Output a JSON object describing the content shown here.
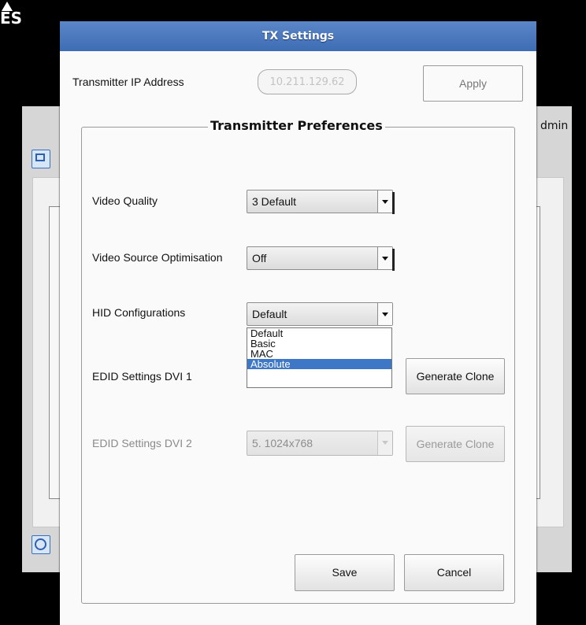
{
  "background": {
    "logo_text": "ES",
    "admin_text": "dmin"
  },
  "dialog": {
    "title": "TX Settings",
    "ip_label": "Transmitter IP Address",
    "ip_value": "10.211.129.62",
    "apply_label": "Apply",
    "group_title": "Transmitter Preferences",
    "fields": {
      "video_quality": {
        "label": "Video Quality",
        "value": "3 Default"
      },
      "video_source_optimisation": {
        "label": "Video Source Optimisation",
        "value": "Off"
      },
      "hid_configurations": {
        "label": "HID Configurations",
        "value": "Default",
        "options": [
          "Default",
          "Basic",
          "MAC",
          "Absolute"
        ],
        "highlighted": "Absolute"
      },
      "edid_dvi1": {
        "label": "EDID Settings  DVI 1",
        "button": "Generate Clone"
      },
      "edid_dvi2": {
        "label": "EDID Settings  DVI 2",
        "value": "5. 1024x768",
        "button": "Generate Clone"
      }
    },
    "save_label": "Save",
    "cancel_label": "Cancel"
  },
  "colors": {
    "title_bar": "#4a78be",
    "highlight": "#3d77c6"
  }
}
